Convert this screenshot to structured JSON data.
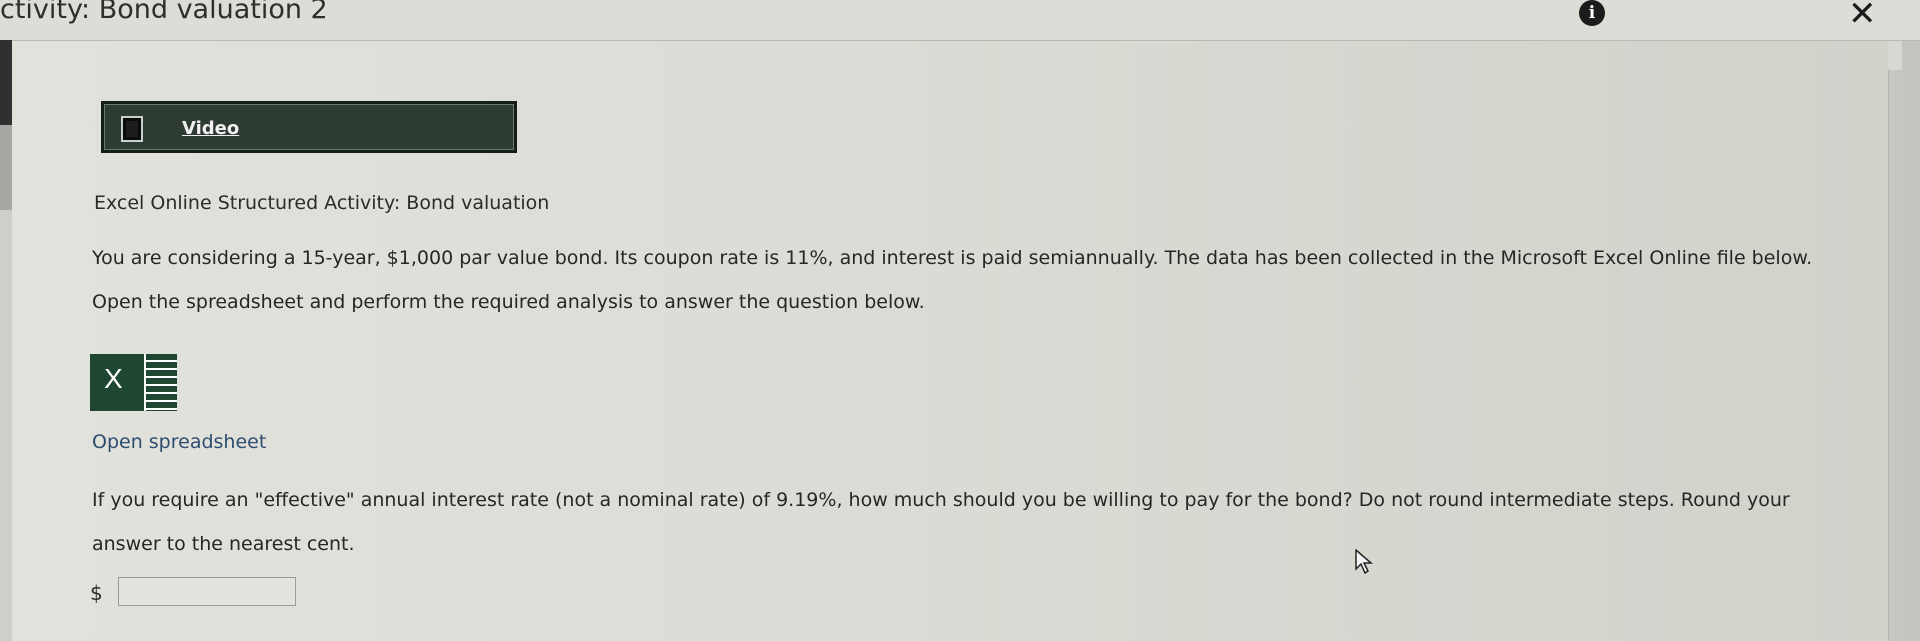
{
  "window": {
    "title": "ctivity: Bond valuation 2",
    "info_icon": "info-icon",
    "close_icon": "close-icon"
  },
  "video": {
    "label": "Video",
    "icon": "film-icon"
  },
  "activity": {
    "heading": "Excel Online Structured Activity: Bond valuation",
    "paragraph": "You are considering a 15-year, $1,000 par value bond. Its coupon rate is 11%, and interest is paid semiannually. The data has been collected in the Microsoft Excel Online file below. Open the spreadsheet and perform the required analysis to answer the question below."
  },
  "spreadsheet": {
    "icon": "excel-icon",
    "icon_letter": "X",
    "link_text": "Open spreadsheet"
  },
  "question": {
    "text": "If you require an \"effective\" annual interest rate (not a nominal rate) of 9.19%, how much should you be willing to pay for the bond? Do not round intermediate steps. Round your answer to the nearest cent."
  },
  "answer": {
    "currency_symbol": "$",
    "value": ""
  },
  "colors": {
    "video_button_bg": "#2e3b33",
    "excel_green": "#1f4630",
    "link_blue": "#2e4d6e"
  }
}
